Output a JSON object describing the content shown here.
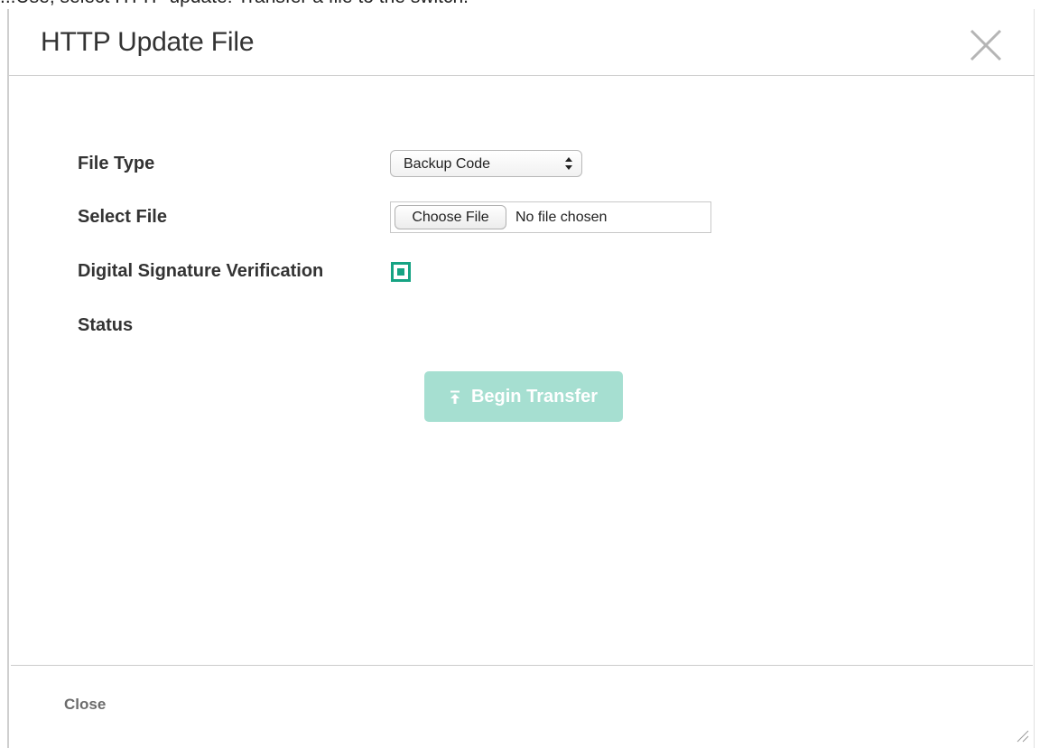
{
  "page_heading_partial": "...Use, select HTTP update: Transfer a file to the switch.",
  "dialog": {
    "title": "HTTP Update File"
  },
  "form": {
    "file_type_label": "File Type",
    "file_type_value": "Backup Code",
    "select_file_label": "Select File",
    "choose_file_label": "Choose File",
    "file_status": "No file chosen",
    "signature_label": "Digital Signature Verification",
    "signature_checked": true,
    "status_label": "Status"
  },
  "actions": {
    "begin_transfer_label": "Begin Transfer",
    "close_label": "Close"
  },
  "colors": {
    "accent": "#16a383",
    "button_disabled": "#a6dfd1"
  },
  "icons": {
    "close": "close-x-icon",
    "transfer": "upload-arrow-icon",
    "select": "updown-arrows-icon",
    "resize": "resize-handle-icon"
  }
}
